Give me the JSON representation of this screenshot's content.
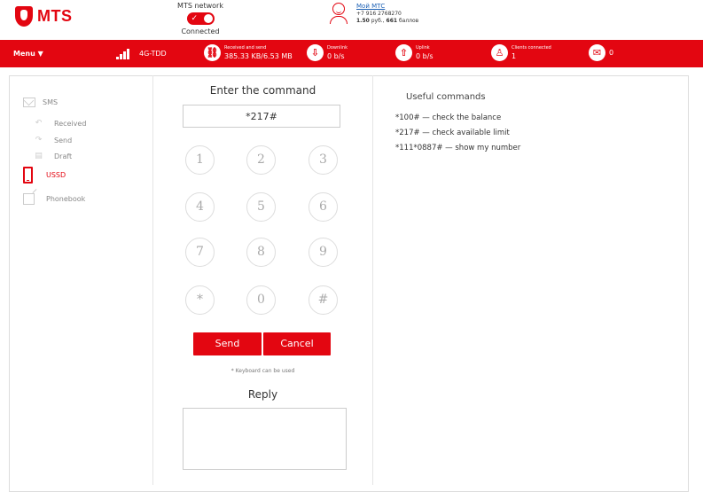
{
  "header": {
    "logo_text": "MTS",
    "network_label": "MTS network",
    "network_status": "Connected",
    "account_link": "Мой МТС",
    "account_phone": "+7 916 2768270",
    "account_balance": "1.50",
    "account_balance_suffix": " руб., ",
    "account_points": "661",
    "account_points_suffix": " баллов"
  },
  "statusbar": {
    "menu_label": "Menu ▼",
    "network_type": "4G-TDD",
    "received_label": "Received and send",
    "received_value": "385.33 KB/6.53 MB",
    "downlink_label": "Downlink",
    "downlink_value": "0 b/s",
    "uplink_label": "Uplink",
    "uplink_value": "0 b/s",
    "clients_label": "Clients connected",
    "clients_value": "1",
    "messages_value": "0"
  },
  "sidebar": {
    "sms": "SMS",
    "received": "Received",
    "send": "Send",
    "draft": "Draft",
    "ussd": "USSD",
    "phonebook": "Phonebook"
  },
  "ussd": {
    "title": "Enter the command",
    "command_value": "*217#",
    "keys": [
      "1",
      "2",
      "3",
      "4",
      "5",
      "6",
      "7",
      "8",
      "9",
      "*",
      "0",
      "#"
    ],
    "send_label": "Send",
    "cancel_label": "Cancel",
    "hint": "* Keyboard can be used",
    "reply_title": "Reply",
    "reply_value": ""
  },
  "useful": {
    "title": "Useful commands",
    "lines": [
      "*100# — check the balance",
      "*217# — check available limit",
      "*111*0887# — show my number"
    ]
  },
  "colors": {
    "brand_red": "#e30611"
  }
}
